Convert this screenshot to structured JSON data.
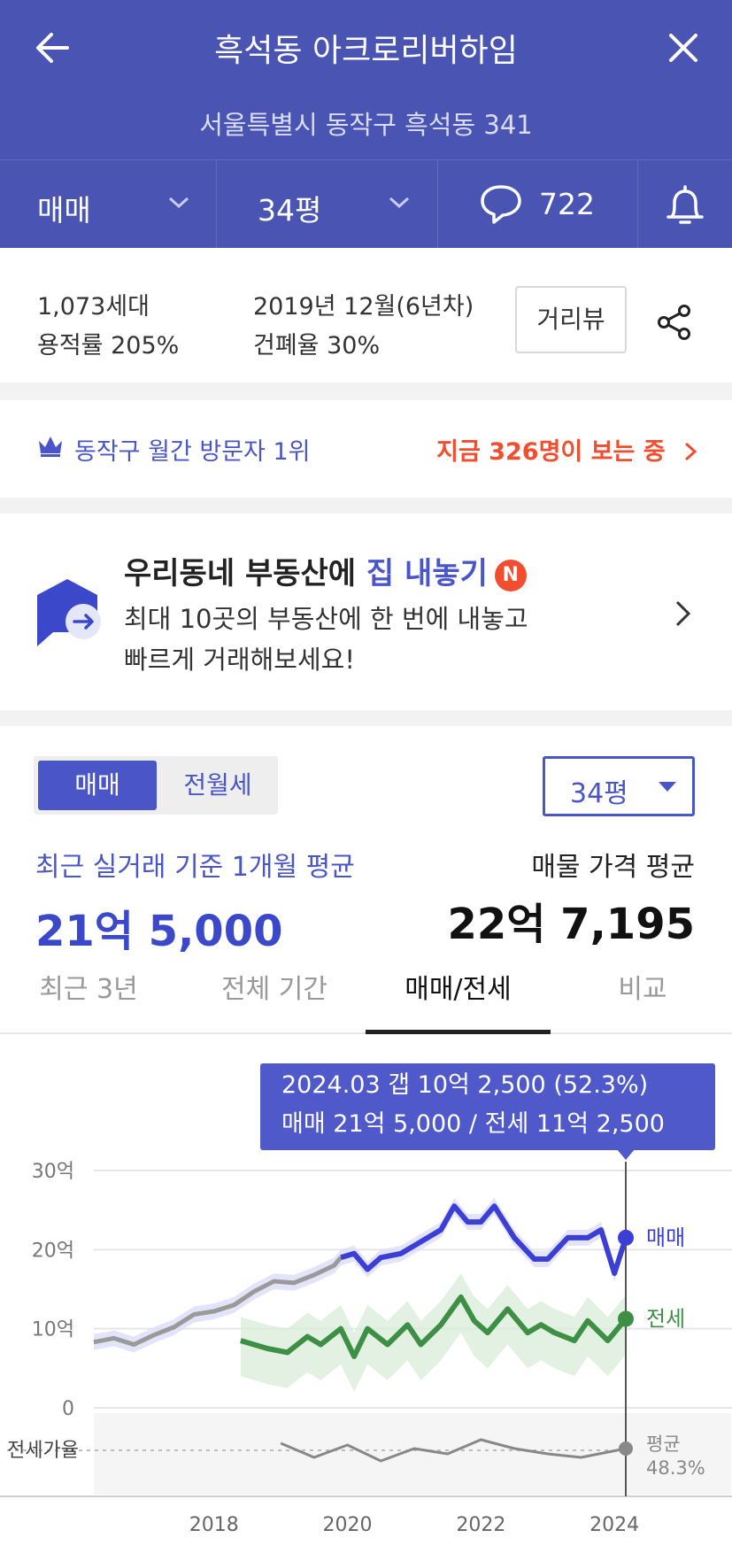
{
  "header": {
    "title": "흑석동 아크로리버하임",
    "address": "서울특별시 동작구 흑석동 341",
    "trade_type": "매매",
    "size": "34평",
    "comment_count": "722"
  },
  "info": {
    "households": "1,073세대",
    "floor_area_ratio": "용적률 205%",
    "built": "2019년 12월(6년차)",
    "coverage_ratio": "건폐율 30%",
    "street_view_label": "거리뷰"
  },
  "rank": {
    "text": "동작구 월간 방문자 1위",
    "viewers": "지금 326명이 보는 중"
  },
  "promo": {
    "title_prefix": "우리동네 부동산에 ",
    "title_highlight": "집 내놓기",
    "badge": "N",
    "line1": "최대 10곳의 부동산에 한 번에 내놓고",
    "line2": "빠르게 거래해보세요!"
  },
  "price": {
    "seg_sale": "매매",
    "seg_rent": "전월세",
    "size_select": "34평",
    "recent_label": "최근 실거래 기준 1개월 평균",
    "recent_value": "21억 5,000",
    "listing_label": "매물 가격 평균",
    "listing_value": "22억 7,195"
  },
  "tabs": [
    "최근 3년",
    "전체 기간",
    "매매/전세",
    "비교"
  ],
  "active_tab": 2,
  "tooltip": {
    "line1": "2024.03  갭 10억 2,500 (52.3%)",
    "line2": "매매 21억 5,000 / 전세 11억 2,500"
  },
  "colors": {
    "brand": "#4a55b3",
    "accent": "#4a55c7",
    "sale_line": "#3b3fd6",
    "presale_line": "#9a9a9a",
    "jeonse_line": "#3d8f45",
    "alert": "#f04e2e"
  },
  "chart_data": {
    "type": "line",
    "x_unit": "year",
    "x_ticks": [
      "2018",
      "2020",
      "2022",
      "2024"
    ],
    "y_ticks": [
      "0",
      "10억",
      "20억",
      "30억"
    ],
    "ylim": [
      0,
      30
    ],
    "y_unit": "억",
    "series": [
      {
        "name": "매매",
        "role": "sale",
        "x": [
          2016.2,
          2016.5,
          2016.8,
          2017.1,
          2017.4,
          2017.7,
          2018.0,
          2018.3,
          2018.6,
          2018.9,
          2019.2,
          2019.5,
          2019.8,
          2019.9,
          2020.1,
          2020.3,
          2020.5,
          2020.8,
          2021.1,
          2021.4,
          2021.6,
          2021.8,
          2022.0,
          2022.2,
          2022.5,
          2022.8,
          2023.0,
          2023.3,
          2023.6,
          2023.8,
          2024.0,
          2024.17
        ],
        "values": [
          8.3,
          8.8,
          8.0,
          9.2,
          10.2,
          11.8,
          12.2,
          13.0,
          14.7,
          16.0,
          15.8,
          16.8,
          18.0,
          19.0,
          19.5,
          17.5,
          19.0,
          19.5,
          21.0,
          22.5,
          25.5,
          23.5,
          23.5,
          25.5,
          21.5,
          18.8,
          18.8,
          21.5,
          21.5,
          22.5,
          17.0,
          21.5
        ]
      },
      {
        "name": "전세",
        "role": "jeonse",
        "x": [
          2018.4,
          2018.8,
          2019.1,
          2019.4,
          2019.6,
          2019.9,
          2020.1,
          2020.3,
          2020.6,
          2020.9,
          2021.1,
          2021.4,
          2021.7,
          2021.9,
          2022.1,
          2022.4,
          2022.7,
          2022.9,
          2023.1,
          2023.4,
          2023.6,
          2023.9,
          2024.17
        ],
        "values": [
          8.5,
          7.5,
          7.0,
          9.0,
          8.0,
          10.0,
          6.5,
          10.0,
          8.0,
          10.5,
          8.0,
          10.5,
          14.0,
          11.0,
          9.5,
          12.5,
          9.5,
          10.5,
          9.5,
          8.5,
          11.0,
          8.5,
          11.25
        ]
      },
      {
        "name": "전세가율",
        "role": "ratio",
        "x": [
          2019.0,
          2019.5,
          2020.0,
          2020.5,
          2021.0,
          2021.5,
          2022.0,
          2022.5,
          2023.0,
          2023.5,
          2024.17
        ],
        "values": [
          55,
          47,
          54,
          45,
          52,
          49,
          57,
          52,
          49,
          47,
          52
        ]
      }
    ],
    "end_labels": [
      "매매",
      "전세",
      "평균",
      "48.3%"
    ],
    "ratio_label": "전세가율",
    "legend": "right"
  }
}
